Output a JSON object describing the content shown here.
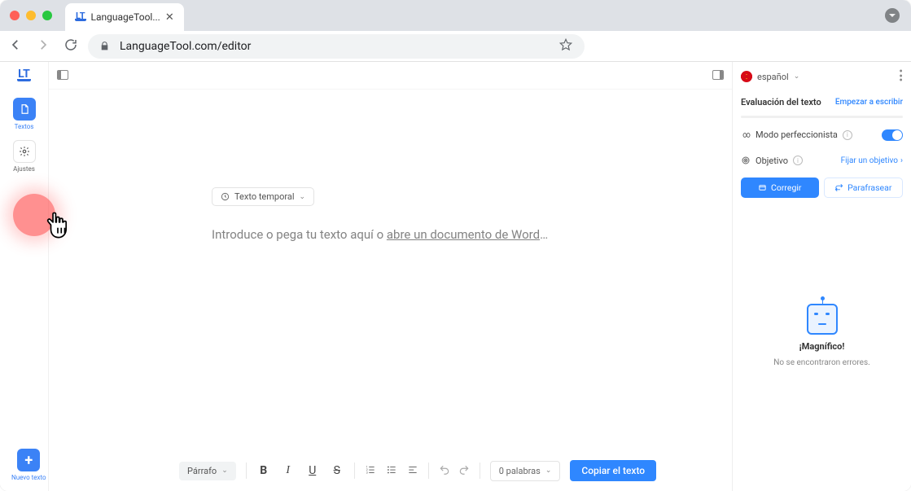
{
  "browser": {
    "tab_title": "LanguageTool...",
    "url": "LanguageTool.com/editor"
  },
  "left_rail": {
    "textos_label": "Textos",
    "ajustes_label": "Ajustes",
    "nuevo_texto_label": "Nuevo texto"
  },
  "editor": {
    "doc_chip_label": "Texto temporal",
    "placeholder_start": "Introduce o pega tu texto aquí o ",
    "placeholder_link": "abre un documento de Word",
    "placeholder_dots": "…"
  },
  "toolbar": {
    "paragraph_label": "Párrafo",
    "word_count_label": "0 palabras",
    "copy_label": "Copiar el texto"
  },
  "right_panel": {
    "language_label": "español",
    "eval_title": "Evaluación del texto",
    "start_writing": "Empezar a escribir",
    "perfeccionista_label": "Modo perfeccionista",
    "objetivo_label": "Objetivo",
    "fijar_objetivo": "Fijar un objetivo",
    "corregir_label": "Corregir",
    "parafrasear_label": "Parafrasear",
    "magnifico": "¡Magnífico!",
    "no_errores": "No se encontraron errores."
  }
}
